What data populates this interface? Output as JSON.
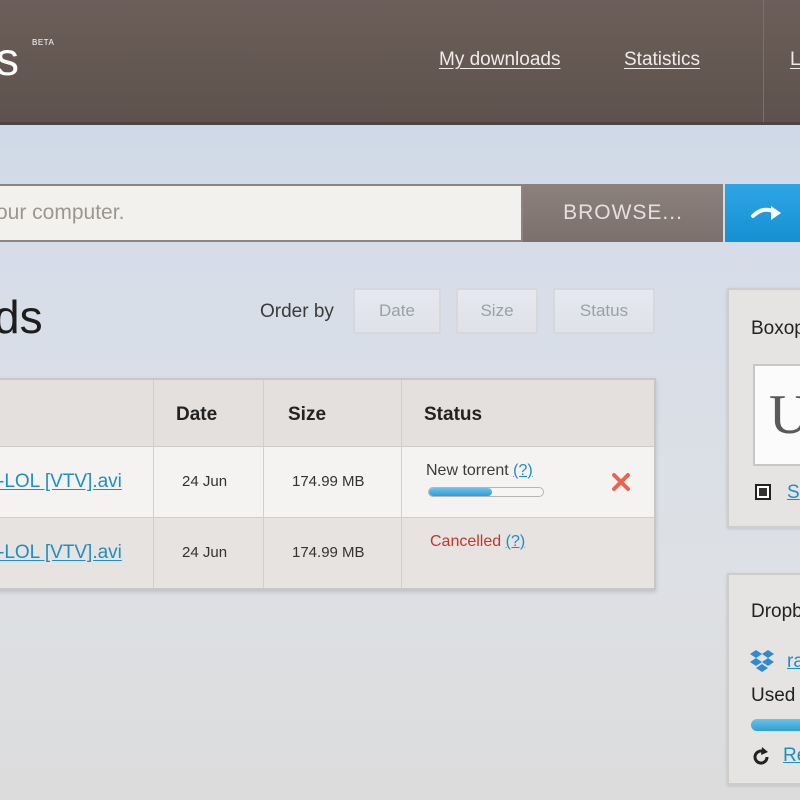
{
  "header": {
    "logo_text": "s",
    "beta_label": "BETA",
    "nav": {
      "my_downloads": "My downloads",
      "statistics": "Statistics",
      "partial": "L"
    }
  },
  "upload": {
    "placeholder": "our computer.",
    "browse_label": "BROWSE..."
  },
  "downloads": {
    "title": "ds",
    "order_by_label": "Order by",
    "order_options": [
      "Date",
      "Size",
      "Status"
    ],
    "columns": {
      "date": "Date",
      "size": "Size",
      "status": "Status"
    },
    "rows": [
      {
        "filename": "-LOL [VTV].avi",
        "date": "24 Jun",
        "size": "174.99 MB",
        "status": "New torrent",
        "help": "(?)",
        "progress": 0.55,
        "deletable": true
      },
      {
        "filename": "-LOL [VTV].avi",
        "date": "24 Jun",
        "size": "174.99 MB",
        "status": "Cancelled",
        "help": "(?)"
      }
    ]
  },
  "sidebar": {
    "boxopus": {
      "title": "Boxop",
      "box_text": "U",
      "link_text": "S"
    },
    "dropbox": {
      "title": "Dropb",
      "account_link": "ra",
      "used_label": "Used",
      "used_fraction": 1.0,
      "refresh_link": "Re"
    }
  },
  "colors": {
    "header_bg": "#5e524d",
    "accent_blue": "#1d8fc0",
    "go_button": "#168fd3",
    "cancel_red": "#c0392b",
    "delete_red": "#e8664f"
  }
}
